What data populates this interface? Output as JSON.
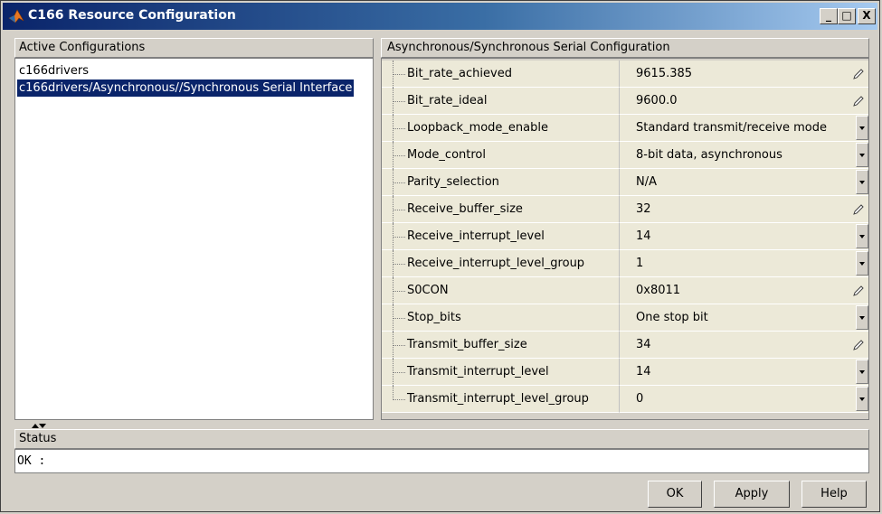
{
  "window": {
    "title": "C166 Resource Configuration",
    "min_label": "_",
    "max_label": "□",
    "close_label": "X"
  },
  "left": {
    "header": "Active Configurations",
    "items": [
      {
        "label": "c166drivers",
        "selected": false
      },
      {
        "label": "c166drivers/Asynchronous//Synchronous Serial Interface",
        "selected": true
      }
    ]
  },
  "right": {
    "header": "Asynchronous/Synchronous Serial Configuration",
    "properties": [
      {
        "name": "Bit_rate_achieved",
        "value": "9615.385",
        "control": "edit"
      },
      {
        "name": "Bit_rate_ideal",
        "value": "9600.0",
        "control": "edit"
      },
      {
        "name": "Loopback_mode_enable",
        "value": "Standard transmit/receive mode",
        "control": "dropdown"
      },
      {
        "name": "Mode_control",
        "value": "8-bit data, asynchronous",
        "control": "dropdown"
      },
      {
        "name": "Parity_selection",
        "value": "N/A",
        "control": "dropdown"
      },
      {
        "name": "Receive_buffer_size",
        "value": "32",
        "control": "edit"
      },
      {
        "name": "Receive_interrupt_level",
        "value": "14",
        "control": "dropdown"
      },
      {
        "name": "Receive_interrupt_level_group",
        "value": "1",
        "control": "dropdown"
      },
      {
        "name": "S0CON",
        "value": "0x8011",
        "control": "edit"
      },
      {
        "name": "Stop_bits",
        "value": "One stop bit",
        "control": "dropdown"
      },
      {
        "name": "Transmit_buffer_size",
        "value": "34",
        "control": "edit"
      },
      {
        "name": "Transmit_interrupt_level",
        "value": "14",
        "control": "dropdown"
      },
      {
        "name": "Transmit_interrupt_level_group",
        "value": "0",
        "control": "dropdown"
      }
    ]
  },
  "status": {
    "header": "Status",
    "text": "OK :"
  },
  "buttons": {
    "ok": "OK",
    "apply": "Apply",
    "help": "Help"
  },
  "colors": {
    "selection": "#0a246a",
    "titlebar_start": "#0a246a",
    "titlebar_end": "#a6caf0",
    "face": "#d4d0c8"
  }
}
